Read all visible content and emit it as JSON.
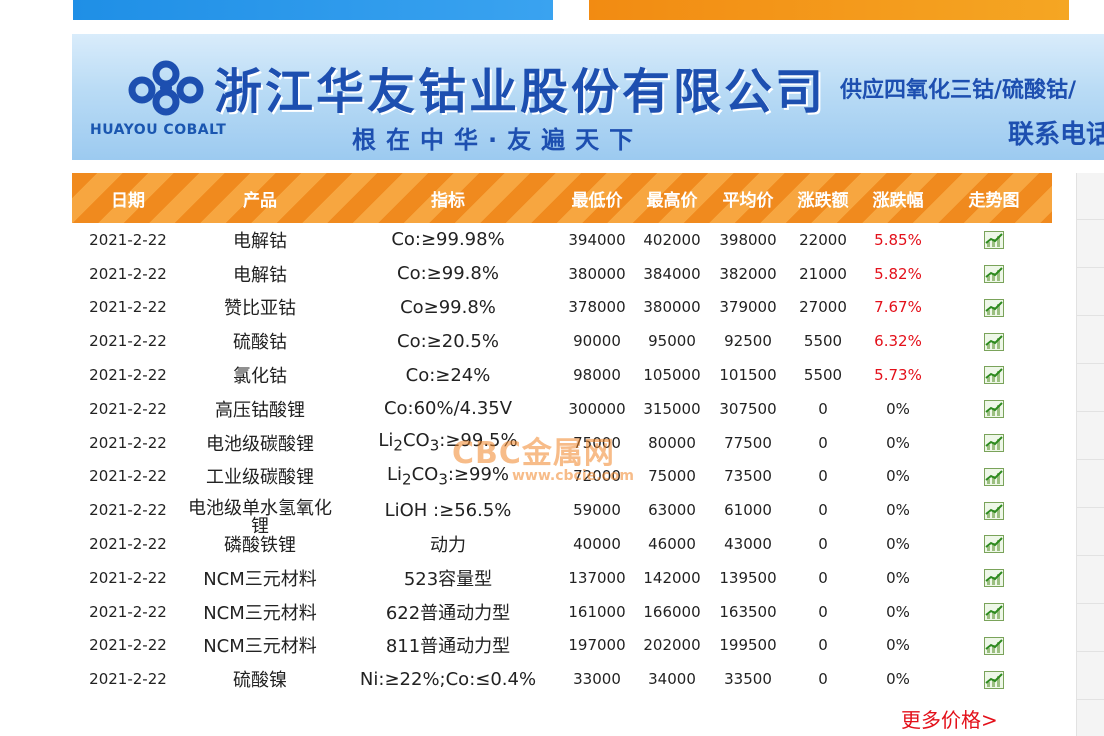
{
  "ad": {
    "logo_text": "HUAYOU COBALT",
    "company": "浙江华友钴业股份有限公司",
    "slogan": "根在中华·友遍天下",
    "supply": "供应四氧化三钴/硫酸钴/",
    "contact": "联系电话"
  },
  "table": {
    "headers": [
      "日期",
      "产品",
      "指标",
      "最低价",
      "最高价",
      "平均价",
      "涨跌额",
      "涨跌幅",
      "走势图"
    ],
    "rows": [
      {
        "date": "2021-2-22",
        "product": "电解钴",
        "spec": "Co:≥99.98%",
        "low": "394000",
        "high": "402000",
        "avg": "398000",
        "change": "22000",
        "pct": "5.85%",
        "up": true
      },
      {
        "date": "2021-2-22",
        "product": "电解钴",
        "spec": "Co:≥99.8%",
        "low": "380000",
        "high": "384000",
        "avg": "382000",
        "change": "21000",
        "pct": "5.82%",
        "up": true
      },
      {
        "date": "2021-2-22",
        "product": "赞比亚钴",
        "spec": "Co≥99.8%",
        "low": "378000",
        "high": "380000",
        "avg": "379000",
        "change": "27000",
        "pct": "7.67%",
        "up": true
      },
      {
        "date": "2021-2-22",
        "product": "硫酸钴",
        "spec": "Co:≥20.5%",
        "low": "90000",
        "high": "95000",
        "avg": "92500",
        "change": "5500",
        "pct": "6.32%",
        "up": true
      },
      {
        "date": "2021-2-22",
        "product": "氯化钴",
        "spec": "Co:≥24%",
        "low": "98000",
        "high": "105000",
        "avg": "101500",
        "change": "5500",
        "pct": "5.73%",
        "up": true
      },
      {
        "date": "2021-2-22",
        "product": "高压钴酸锂",
        "spec": "Co:60%/4.35V",
        "low": "300000",
        "high": "315000",
        "avg": "307500",
        "change": "0",
        "pct": "0%",
        "up": false
      },
      {
        "date": "2021-2-22",
        "product": "电池级碳酸锂",
        "spec": "Li2CO3:≥99.5%",
        "low": "75000",
        "high": "80000",
        "avg": "77500",
        "change": "0",
        "pct": "0%",
        "up": false
      },
      {
        "date": "2021-2-22",
        "product": "工业级碳酸锂",
        "spec": "Li2CO3:≥99%",
        "low": "72000",
        "high": "75000",
        "avg": "73500",
        "change": "0",
        "pct": "0%",
        "up": false
      },
      {
        "date": "2021-2-22",
        "product": "电池级单水氢氧化锂",
        "spec": "LiOH :≥56.5%",
        "low": "59000",
        "high": "63000",
        "avg": "61000",
        "change": "0",
        "pct": "0%",
        "up": false
      },
      {
        "date": "2021-2-22",
        "product": "磷酸铁锂",
        "spec": "动力",
        "low": "40000",
        "high": "46000",
        "avg": "43000",
        "change": "0",
        "pct": "0%",
        "up": false
      },
      {
        "date": "2021-2-22",
        "product": "NCM三元材料",
        "spec": "523容量型",
        "low": "137000",
        "high": "142000",
        "avg": "139500",
        "change": "0",
        "pct": "0%",
        "up": false
      },
      {
        "date": "2021-2-22",
        "product": "NCM三元材料",
        "spec": "622普通动力型",
        "low": "161000",
        "high": "166000",
        "avg": "163500",
        "change": "0",
        "pct": "0%",
        "up": false
      },
      {
        "date": "2021-2-22",
        "product": "NCM三元材料",
        "spec": "811普通动力型",
        "low": "197000",
        "high": "202000",
        "avg": "199500",
        "change": "0",
        "pct": "0%",
        "up": false
      },
      {
        "date": "2021-2-22",
        "product": "硫酸镍",
        "spec": "Ni:≥22%;Co:≤0.4%",
        "low": "33000",
        "high": "34000",
        "avg": "33500",
        "change": "0",
        "pct": "0%",
        "up": false
      }
    ]
  },
  "more_link": "更多价格>",
  "watermark": {
    "main": "CBC金属网",
    "sub": "www.cbcie.com"
  },
  "colors": {
    "header_orange": "#f08a1e",
    "up_red": "#e3101a",
    "ad_blue": "#1d4fb0"
  },
  "icons": {
    "trend": "trend-chart-icon",
    "logo": "huayou-logo-icon"
  }
}
